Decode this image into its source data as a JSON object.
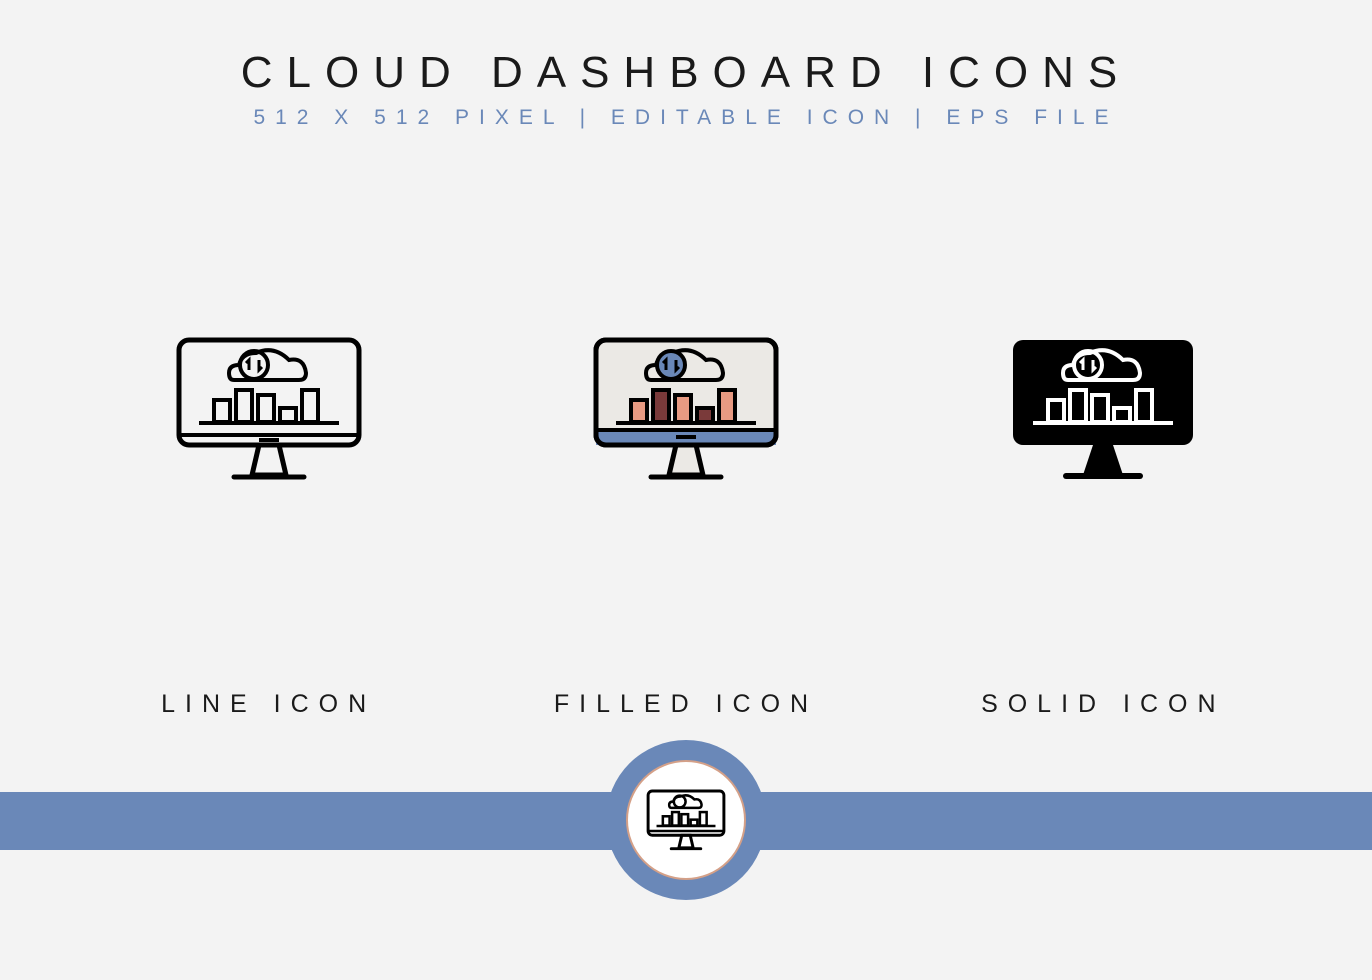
{
  "header": {
    "title": "CLOUD DASHBOARD ICONS",
    "subtitle": "512 X 512 PIXEL | EDITABLE ICON | EPS FILE"
  },
  "icons": {
    "line_label": "LINE ICON",
    "filled_label": "FILLED ICON",
    "solid_label": "SOLID ICON"
  },
  "colors": {
    "accent": "#6a88b8",
    "salmon": "#e89a82",
    "dark_red": "#7a3a3a"
  }
}
